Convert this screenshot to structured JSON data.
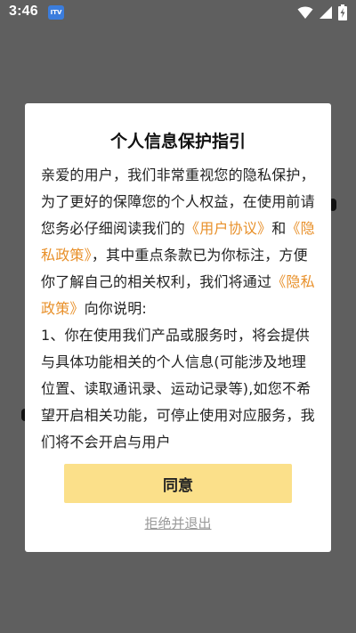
{
  "status_bar": {
    "time": "3:46",
    "app_badge": "ITV"
  },
  "dialog": {
    "title": "个人信息保护指引",
    "body": {
      "p1": "亲爱的用户，我们非常重视您的隐私保护，为了更好的保障您的个人权益，在使用前请您务必仔细阅读我们的",
      "link_user_agreement": "《用户协议》",
      "p2": "和",
      "link_privacy_policy_1": "《隐私政策》",
      "p3": "，其中重点条款已为你标注，方便你了解自己的相关权利，我们将通过",
      "link_privacy_policy_2": "《隐私政策》",
      "p4": "向你说明:",
      "p5": "1、你在使用我们产品或服务时，将会提供与具体功能相关的个人信息(可能涉及地理位置、读取通讯录、运动记录等),如您不希望开启相关功能，可停止使用对应服务，我们将不会开启与用户"
    },
    "agree_label": "同意",
    "decline_label": "拒绝并退出"
  },
  "colors": {
    "overlay": "#5f5f5f",
    "link": "#e8902a",
    "agree_button": "#fbe08a",
    "decline_text": "#9a9a9a"
  },
  "icons": {
    "wifi": "wifi-icon",
    "signal": "signal-icon",
    "battery": "battery-charging-icon"
  }
}
